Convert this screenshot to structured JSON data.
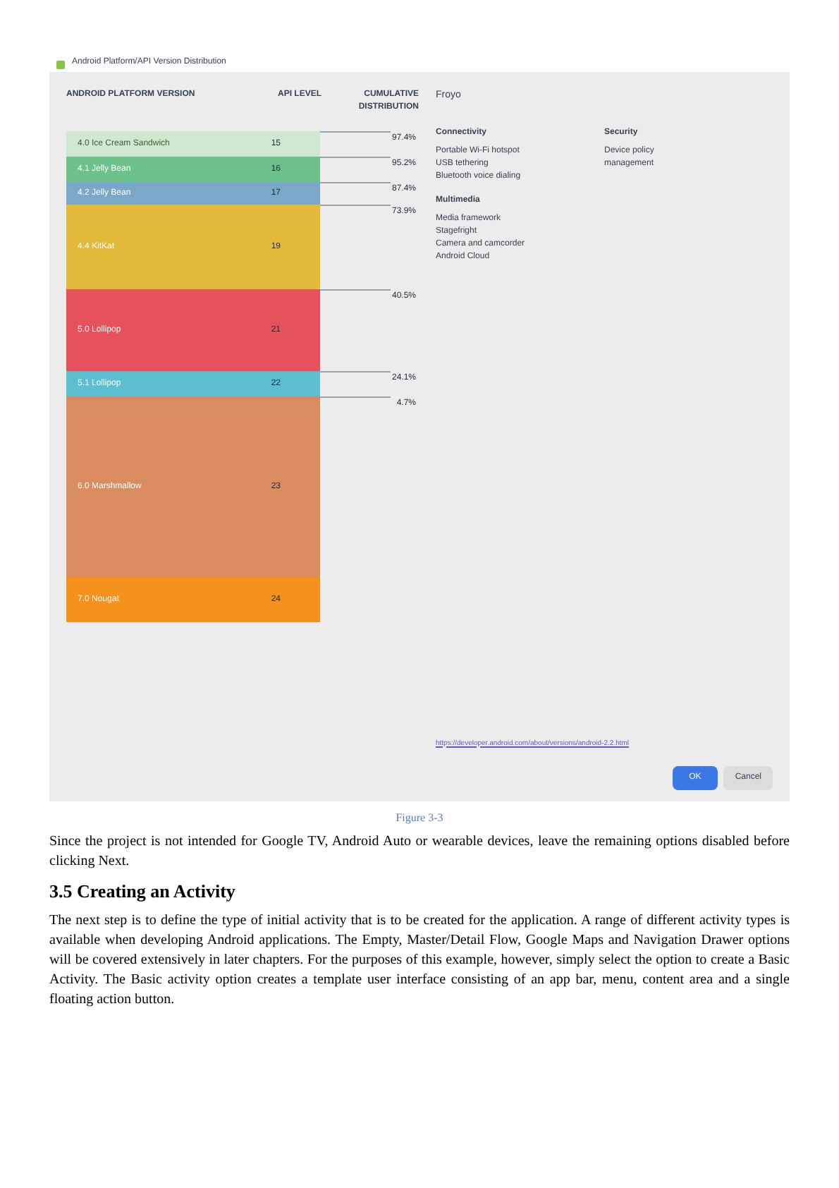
{
  "dialog": {
    "title": "Android Platform/API Version Distribution",
    "columns": [
      "ANDROID PLATFORM VERSION",
      "API LEVEL",
      "CUMULATIVE DISTRIBUTION"
    ],
    "rows": [
      {
        "version": "4.0",
        "name": "Ice Cream Sandwich",
        "api": "15",
        "distribution": "97.4%",
        "color": "#cfe8cf"
      },
      {
        "version": "4.1",
        "name": "Jelly Bean",
        "api": "16",
        "distribution": "95.2%",
        "color": "#6cc28a"
      },
      {
        "version": "4.2",
        "name": "Jelly Bean",
        "api": "17",
        "distribution": "87.4%",
        "color": "#7ba7c9"
      },
      {
        "version": "4.4",
        "name": "KitKat",
        "api": "19",
        "distribution": "73.9%",
        "color": "#e3b93a"
      },
      {
        "version": "5.0",
        "name": "Lollipop",
        "api": "21",
        "distribution": "40.5%",
        "color": "#e5525c"
      },
      {
        "version": "5.1",
        "name": "Lollipop",
        "api": "22",
        "distribution": "24.1%",
        "color": "#5bbfd1"
      },
      {
        "version": "6.0",
        "name": "Marshmallow",
        "api": "23",
        "distribution": "4.7%",
        "color": "#d98c5f"
      },
      {
        "version": "7.0",
        "name": "Nougat",
        "api": "24",
        "color": "#f5921e"
      }
    ],
    "detail": {
      "title": "Froyo",
      "sections": [
        {
          "heading": "Connectivity",
          "lines": [
            "Portable Wi-Fi hotspot",
            "USB tethering",
            "Bluetooth voice dialing"
          ]
        },
        {
          "heading": "Security",
          "lines": [
            "Device policy",
            "management"
          ]
        },
        {
          "heading": "Multimedia",
          "lines": [
            "Media framework",
            "Stagefright",
            "Camera and camcorder",
            "Android Cloud"
          ]
        }
      ]
    },
    "link": "https://developer.android.com/about/versions/android-2.2.html",
    "buttons": [
      {
        "label": "OK",
        "primary": true
      },
      {
        "label": "Cancel",
        "primary": false
      }
    ]
  },
  "caption": "Figure 3-3",
  "paragraphs": [
    {
      "kind": "body",
      "text": "Since the project is not intended for Google TV, Android Auto or wearable devices, leave the remaining options disabled before clicking Next."
    },
    {
      "kind": "heading",
      "text": "3.5 Creating an Activity"
    },
    {
      "kind": "body",
      "text": "The next step is to define the type of initial activity that is to be created for the application. A range of different activity types is available when developing Android applications. The Empty, Master/Detail Flow, Google Maps and Navigation Drawer options will be covered extensively in later chapters. For the purposes of this example, however, simply select the option to create a Basic Activity. The Basic activity option creates a template user interface consisting of an app bar, menu, content area and a single floating action button."
    }
  ]
}
